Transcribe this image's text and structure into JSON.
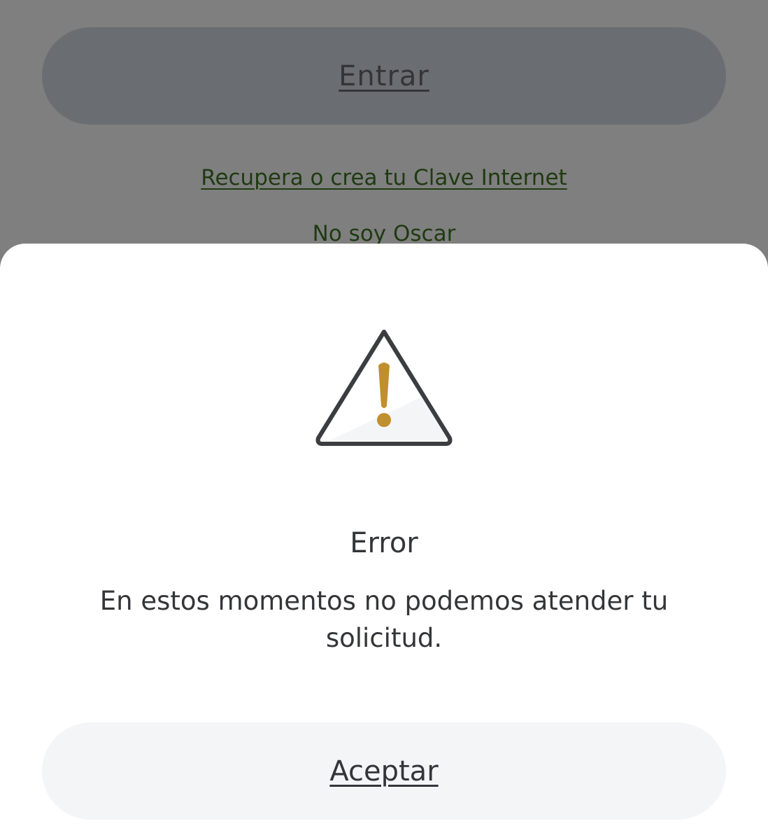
{
  "background": {
    "enter_button_label": "Entrar",
    "recover_link": "Recupera o crea tu Clave Internet",
    "not_user_link": "No soy Oscar"
  },
  "dialog": {
    "icon": "warning-triangle-icon",
    "title": "Error",
    "message": "En estos momentos no podemos atender tu solicitud.",
    "accept_label": "Aceptar"
  },
  "colors": {
    "overlay": "#7f7f7f",
    "link_green": "#1f3a12",
    "warning_gold": "#c08f2e",
    "text_dark": "#343538",
    "button_light": "#f4f5f7"
  }
}
